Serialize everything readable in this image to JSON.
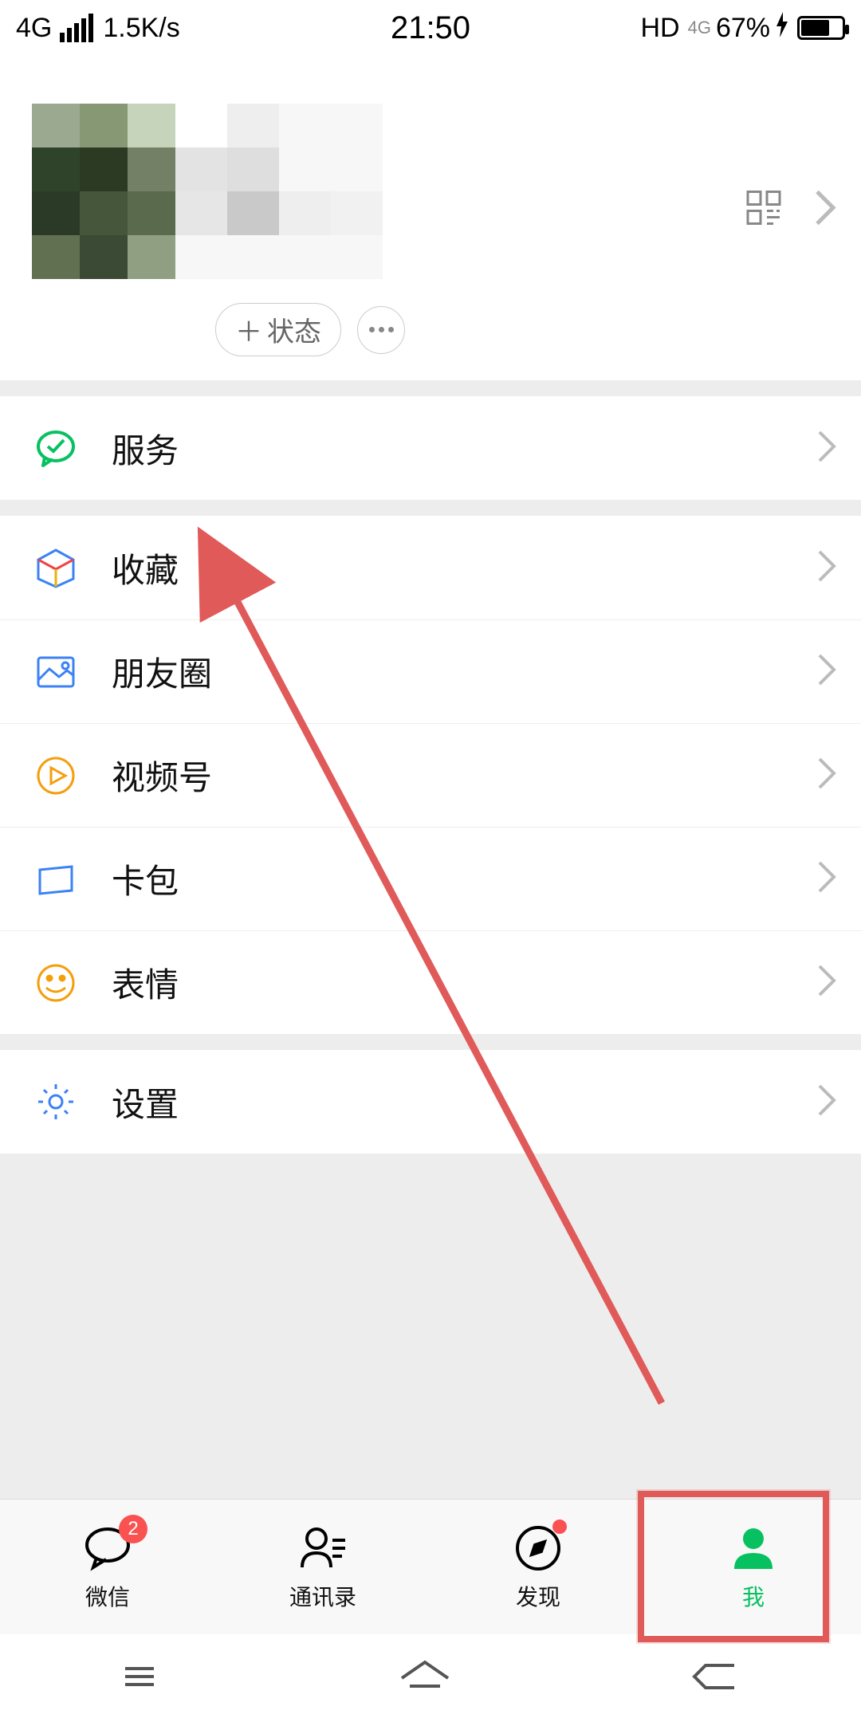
{
  "statusbar": {
    "net_mode": "4G",
    "speed": "1.5K/s",
    "time": "21:50",
    "hd": "HD",
    "net_mode2": "4G",
    "battery_pct": "67%"
  },
  "profile": {
    "status_btn_label": "状态",
    "status_btn_plus": "＋"
  },
  "menu": {
    "services": "服务",
    "favorites": "收藏",
    "moments": "朋友圈",
    "channels": "视频号",
    "cards": "卡包",
    "stickers": "表情",
    "settings": "设置"
  },
  "tabs": {
    "chat": {
      "label": "微信",
      "badge": "2"
    },
    "contacts": {
      "label": "通讯录"
    },
    "discover": {
      "label": "发现"
    },
    "me": {
      "label": "我"
    }
  },
  "colors": {
    "accent": "#07c160",
    "annotation": "#e05a5a",
    "badge": "#fa5151"
  }
}
